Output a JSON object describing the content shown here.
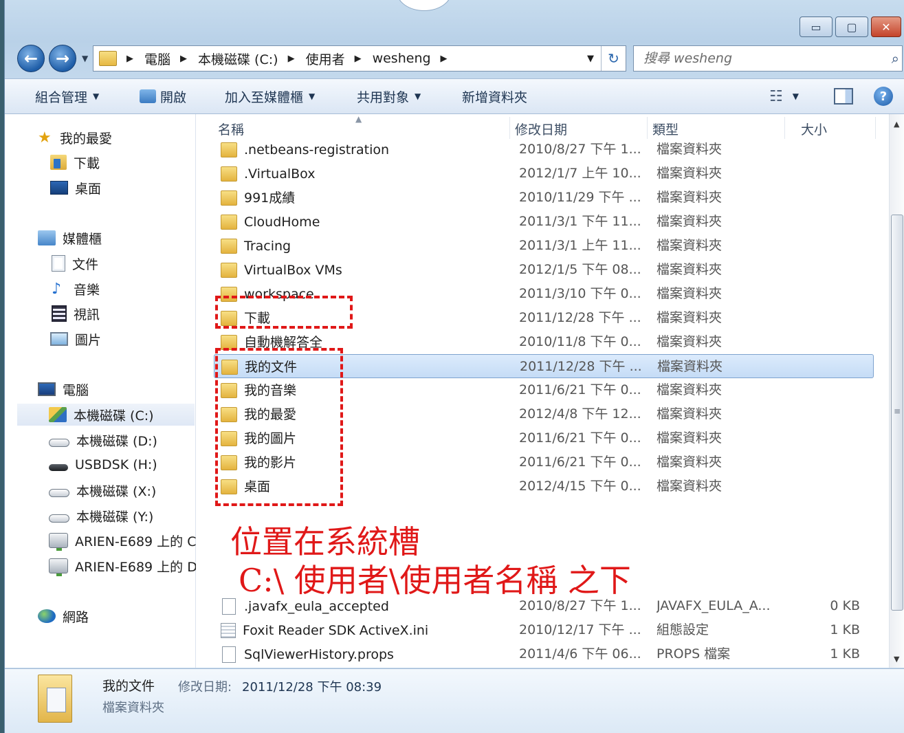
{
  "window": {
    "caption_buttons": {
      "minimize": "▭",
      "maximize": "▢",
      "close": "✕"
    }
  },
  "address": {
    "back_glyph": "←",
    "forward_glyph": "→",
    "breadcrumbs": [
      "電腦",
      "本機磁碟 (C:)",
      "使用者",
      "wesheng"
    ],
    "dropdown_glyph": "▼",
    "refresh_glyph": "↻"
  },
  "search": {
    "placeholder": "搜尋 wesheng",
    "icon": "search-icon",
    "icon_glyph": "⌕"
  },
  "toolbar": {
    "organize": "組合管理",
    "open": "開啟",
    "add_to_library": "加入至媒體櫃",
    "share_with": "共用對象",
    "new_folder": "新增資料夾",
    "dd_glyph": "▼",
    "view_glyph": "☷",
    "help_glyph": "?"
  },
  "sidebar": {
    "favorites": {
      "label": "我的最愛",
      "items": [
        "下載",
        "桌面"
      ]
    },
    "libraries": {
      "label": "媒體櫃",
      "items": [
        "文件",
        "音樂",
        "視訊",
        "圖片"
      ]
    },
    "computer": {
      "label": "電腦",
      "items": [
        "本機磁碟 (C:)",
        "本機磁碟 (D:)",
        "USBDSK (H:)",
        "本機磁碟 (X:)",
        "本機磁碟 (Y:)",
        "ARIEN-E689 上的 C",
        "ARIEN-E689 上的 D"
      ]
    },
    "network": {
      "label": "網路"
    },
    "glyphs": {
      "star": "★",
      "note": "♪"
    }
  },
  "columns": {
    "name": "名稱",
    "date": "修改日期",
    "type": "類型",
    "size": "大小",
    "sort_glyph": "▲"
  },
  "files": [
    {
      "name": ".netbeans-registration",
      "date": "2010/8/27 下午 1...",
      "type": "檔案資料夾",
      "size": ""
    },
    {
      "name": ".VirtualBox",
      "date": "2012/1/7 上午 10...",
      "type": "檔案資料夾",
      "size": ""
    },
    {
      "name": "991成績",
      "date": "2010/11/29 下午 ...",
      "type": "檔案資料夾",
      "size": ""
    },
    {
      "name": "CloudHome",
      "date": "2011/3/1 下午 11...",
      "type": "檔案資料夾",
      "size": ""
    },
    {
      "name": "Tracing",
      "date": "2011/3/1 上午 11...",
      "type": "檔案資料夾",
      "size": ""
    },
    {
      "name": "VirtualBox VMs",
      "date": "2012/1/5 下午 08...",
      "type": "檔案資料夾",
      "size": ""
    },
    {
      "name": "workspace",
      "date": "2011/3/10 下午 0...",
      "type": "檔案資料夾",
      "size": ""
    },
    {
      "name": "下載",
      "date": "2011/12/28 下午 ...",
      "type": "檔案資料夾",
      "size": ""
    },
    {
      "name": "自動機解答全",
      "date": "2010/11/8 下午 0...",
      "type": "檔案資料夾",
      "size": ""
    },
    {
      "name": "我的文件",
      "date": "2011/12/28 下午 ...",
      "type": "檔案資料夾",
      "size": ""
    },
    {
      "name": "我的音樂",
      "date": "2011/6/21 下午 0...",
      "type": "檔案資料夾",
      "size": ""
    },
    {
      "name": "我的最愛",
      "date": "2012/4/8 下午 12...",
      "type": "檔案資料夾",
      "size": ""
    },
    {
      "name": "我的圖片",
      "date": "2011/6/21 下午 0...",
      "type": "檔案資料夾",
      "size": ""
    },
    {
      "name": "我的影片",
      "date": "2011/6/21 下午 0...",
      "type": "檔案資料夾",
      "size": ""
    },
    {
      "name": "桌面",
      "date": "2012/4/15 下午 0...",
      "type": "檔案資料夾",
      "size": ""
    },
    {
      "name": ".javafx_eula_accepted",
      "date": "2010/8/27 下午 1...",
      "type": "JAVAFX_EULA_A...",
      "size": "0 KB"
    },
    {
      "name": "Foxit Reader SDK ActiveX.ini",
      "date": "2010/12/17 下午 ...",
      "type": "組態設定",
      "size": "1 KB"
    },
    {
      "name": "SqlViewerHistory.props",
      "date": "2011/4/6 下午 06...",
      "type": "PROPS 檔案",
      "size": "1 KB"
    }
  ],
  "annotation": {
    "line1": "位置在系統槽",
    "line2": "C:\\ 使用者\\使用者名稱  之下"
  },
  "scrollbar": {
    "up": "▲",
    "down": "▼",
    "grip": "≡"
  },
  "details": {
    "name": "我的文件",
    "date_label": "修改日期:",
    "date_value": "2011/12/28 下午 08:39",
    "type": "檔案資料夾"
  }
}
